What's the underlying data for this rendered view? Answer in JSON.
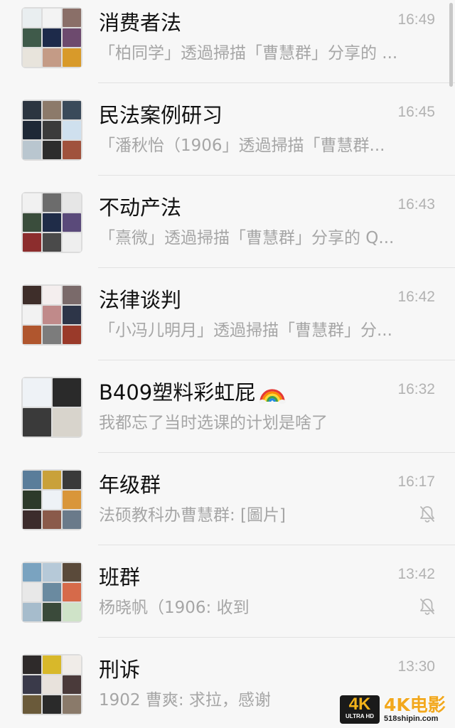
{
  "chats": [
    {
      "name": "消费者法",
      "time": "16:49",
      "preview": "「柏同学」透過掃描「曹慧群」分享的 ...",
      "muted": false,
      "avatar_colors": [
        "#e9eef0",
        "#f3f3f3",
        "#8a6f68",
        "#3f5a4a",
        "#1d2a4a",
        "#6d4a6e",
        "#e8e4dc",
        "#c49b86",
        "#d89a2a"
      ]
    },
    {
      "name": "民法案例研习",
      "time": "16:45",
      "preview": "「潘秋怡（1906」透過掃描「曹慧群...",
      "muted": false,
      "avatar_colors": [
        "#2c3540",
        "#8c7a6a",
        "#3a4a5a",
        "#1e2836",
        "#3b3b3b",
        "#cfe0ee",
        "#b9c6cf",
        "#2d2d2d",
        "#a0523d"
      ]
    },
    {
      "name": "不动产法",
      "time": "16:43",
      "preview": "「熹微」透過掃描「曹慧群」分享的 Q...",
      "muted": false,
      "avatar_colors": [
        "#f1f1f1",
        "#6c6c6c",
        "#e6e6e6",
        "#3a4d3c",
        "#1f2c48",
        "#5a4a7a",
        "#8c2d2d",
        "#4a4a4a",
        "#eeeeee"
      ]
    },
    {
      "name": "法律谈判",
      "time": "16:42",
      "preview": "「小冯儿明月」透過掃描「曹慧群」分...",
      "muted": false,
      "avatar_colors": [
        "#3e2e2a",
        "#f4eeee",
        "#7a6a6a",
        "#f2f2f2",
        "#c08a8a",
        "#2d3548",
        "#b0562e",
        "#7c7c7c",
        "#9a3a2a"
      ]
    },
    {
      "name": "B409塑料彩虹屁",
      "name_icon": "rainbow-icon",
      "time": "16:32",
      "preview": "我都忘了当时选课的计划是啥了",
      "muted": false,
      "avatar_colors": [
        "#eef2f6",
        "#2a2a2a",
        "#3a3a3a",
        "#d8d4cc"
      ]
    },
    {
      "name": "年级群",
      "time": "16:17",
      "preview": "法硕教科办曹慧群: [圖片]",
      "muted": true,
      "avatar_colors": [
        "#5a7d9a",
        "#c9a13a",
        "#3a3a3a",
        "#2d3a2a",
        "#eef2f6",
        "#d9963a",
        "#3c2c2c",
        "#8a5a4a",
        "#6a7a8a"
      ]
    },
    {
      "name": "班群",
      "time": "13:42",
      "preview": "杨晓帆（1906: 收到",
      "muted": true,
      "avatar_colors": [
        "#7aa3c0",
        "#b6c9d8",
        "#5a4a3a",
        "#e8e8e8",
        "#6a8aa0",
        "#d66a4a",
        "#a6bccc",
        "#3a4a3a",
        "#cfe3c8"
      ]
    },
    {
      "name": "刑诉",
      "time": "13:30",
      "preview": "1902 曹爽: 求拉，感谢",
      "muted": false,
      "avatar_colors": [
        "#2e2a2a",
        "#d8b82a",
        "#f0ece8",
        "#3a3a4a",
        "#e8e2dc",
        "#4a3a3a",
        "#6a5a3a",
        "#2a2a2a",
        "#8a7a6a"
      ]
    }
  ],
  "watermark": {
    "badge_big": "4K",
    "badge_small": "ULTRA HD",
    "title": "4K电影",
    "url": "518shipin.com"
  }
}
